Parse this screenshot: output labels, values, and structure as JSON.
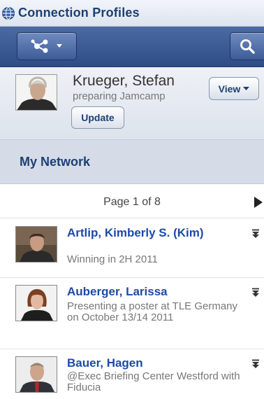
{
  "app": {
    "title": "Connection Profiles",
    "icon": "globe-icon"
  },
  "toolbar": {
    "network_menu_icon": "network-icon",
    "search_icon": "search-icon",
    "accent": "#3a5892"
  },
  "profile": {
    "name": "Krueger, Stefan",
    "status": "preparing Jamcamp",
    "view_label": "View",
    "update_label": "Update"
  },
  "section": {
    "title": "My Network"
  },
  "pager": {
    "label": "Page 1 of 8"
  },
  "contacts": [
    {
      "name": "Artlip, Kimberly S. (Kim)",
      "status": "Winning in 2H 2011"
    },
    {
      "name": "Auberger, Larissa",
      "status": "Presenting a poster at TLE Germany on October 13/14 2011"
    },
    {
      "name": "Bauer, Hagen",
      "status": "@Exec Briefing Center Westford with Fiducia"
    }
  ],
  "colors": {
    "link": "#1d4aa8",
    "header_text": "#1d3f73",
    "section_bg": "#d5dce8"
  }
}
